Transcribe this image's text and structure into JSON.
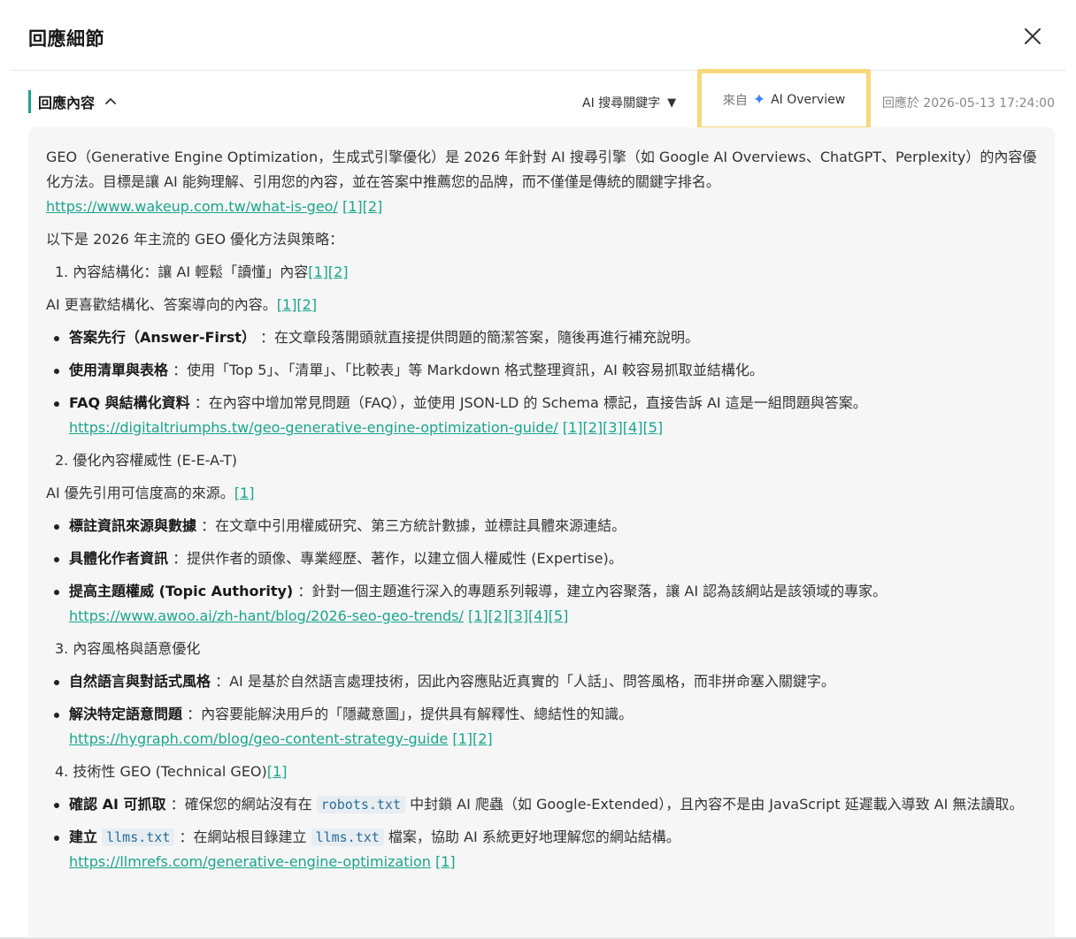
{
  "modal": {
    "title": "回應細節"
  },
  "section": {
    "title": "回應內容",
    "keyword_dropdown": "AI 搜尋關鍵字",
    "source_from": "來自",
    "source_name": "AI Overview",
    "reply_time": "回應於 2026-05-13 17:24:00"
  },
  "icons": {
    "close": "close-icon",
    "collapse": "chevron-up-icon",
    "dropdown": "caret-down-icon",
    "source": "sparkle-icon"
  },
  "colors": {
    "accent": "#1aa58c",
    "highlight_border": "#f7d97a",
    "sparkle": "#3b82f6"
  },
  "content": {
    "intro": "GEO（Generative Engine Optimization，生成式引擎優化）是 2026 年針對 AI 搜尋引擎（如 Google AI Overviews、ChatGPT、Perplexity）的內容優化方法。目標是讓 AI 能夠理解、引用您的內容，並在答案中推薦您的品牌，而不僅僅是傳統的關鍵字排名。",
    "intro_link": "https://www.wakeup.com.tw/what-is-geo/",
    "intro_refs": "[1][2]",
    "lead": "以下是 2026 年主流的 GEO 優化方法與策略：",
    "s1_title": "1. 內容結構化：讓 AI 輕鬆「讀懂」內容",
    "s1_title_refs": "[1][2]",
    "s1_desc": "AI 更喜歡結構化、答案導向的內容。",
    "s1_desc_refs": "[1][2]",
    "s1_b1_bold": "答案先行（Answer-First）",
    "s1_b1_text": "：在文章段落開頭就直接提供問題的簡潔答案，隨後再進行補充說明。",
    "s1_b2_bold": "使用清單與表格",
    "s1_b2_text": "：使用「Top 5」、「清單」、「比較表」等 Markdown 格式整理資訊，AI 較容易抓取並結構化。",
    "s1_b3_bold": "FAQ 與結構化資料",
    "s1_b3_text": "：在內容中增加常見問題（FAQ），並使用 JSON-LD 的 Schema 標記，直接告訴 AI 這是一組問題與答案。",
    "s1_link": "https://digitaltriumphs.tw/geo-generative-engine-optimization-guide/",
    "s1_link_refs": "[1][2][3][4][5]",
    "s2_title": "2. 優化內容權威性 (E-E-A-T)",
    "s2_desc": "AI 優先引用可信度高的來源。",
    "s2_desc_refs": "[1]",
    "s2_b1_bold": "標註資訊來源與數據",
    "s2_b1_text": "：在文章中引用權威研究、第三方統計數據，並標註具體來源連結。",
    "s2_b2_bold": "具體化作者資訊",
    "s2_b2_text": "：提供作者的頭像、專業經歷、著作，以建立個人權威性 (Expertise)。",
    "s2_b3_bold": "提高主題權威 (Topic Authority)",
    "s2_b3_text": "：針對一個主題進行深入的專題系列報導，建立內容聚落，讓 AI 認為該網站是該領域的專家。",
    "s2_link": "https://www.awoo.ai/zh-hant/blog/2026-seo-geo-trends/",
    "s2_link_refs": "[1][2][3][4][5]",
    "s3_title": "3. 內容風格與語意優化",
    "s3_b1_bold": "自然語言與對話式風格",
    "s3_b1_text": "：AI 是基於自然語言處理技術，因此內容應貼近真實的「人話」、問答風格，而非拼命塞入關鍵字。",
    "s3_b2_bold": "解決特定語意問題",
    "s3_b2_text": "：內容要能解決用戶的「隱藏意圖」，提供具有解釋性、總結性的知識。",
    "s3_link": "https://hygraph.com/blog/geo-content-strategy-guide",
    "s3_link_refs": "[1][2]",
    "s4_title": "4. 技術性 GEO (Technical GEO)",
    "s4_title_refs": "[1]",
    "s4_b1_bold": "確認 AI 可抓取",
    "s4_b1_pre": "：確保您的網站沒有在",
    "s4_b1_code": "robots.txt",
    "s4_b1_post": "中封鎖 AI 爬蟲（如 Google-Extended），且內容不是由 JavaScript 延遲載入導致 AI 無法讀取。",
    "s4_b2_bold": "建立",
    "s4_b2_bold_code": "llms.txt",
    "s4_b2_pre": "：在網站根目錄建立",
    "s4_b2_code": "llms.txt",
    "s4_b2_post": "檔案，協助 AI 系統更好地理解您的網站結構。",
    "s4_link": "https://llmrefs.com/generative-engine-optimization",
    "s4_link_refs": "[1]"
  }
}
